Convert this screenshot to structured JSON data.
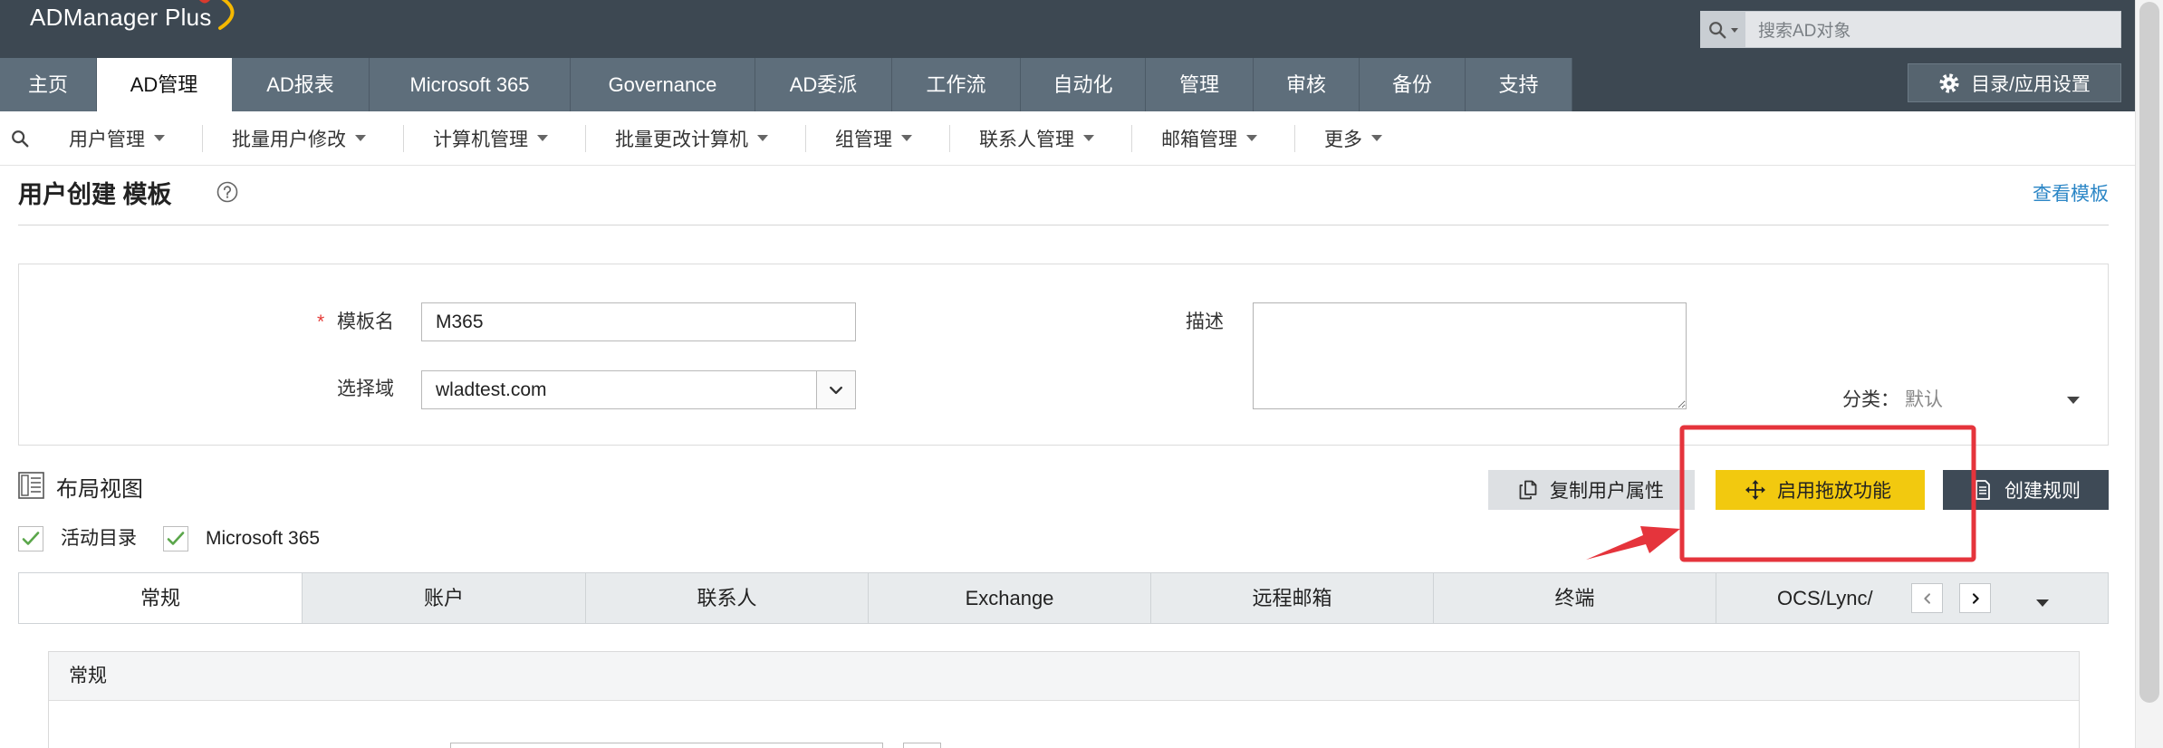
{
  "app": {
    "logo_text": "ADManager Plus"
  },
  "header_search": {
    "placeholder": "搜索AD对象"
  },
  "nav": {
    "tabs": [
      {
        "label": "主页",
        "active": false
      },
      {
        "label": "AD管理",
        "active": true
      },
      {
        "label": "AD报表",
        "active": false
      },
      {
        "label": "Microsoft 365",
        "active": false
      },
      {
        "label": "Governance",
        "active": false
      },
      {
        "label": "AD委派",
        "active": false
      },
      {
        "label": "工作流",
        "active": false
      },
      {
        "label": "自动化",
        "active": false
      },
      {
        "label": "管理",
        "active": false
      },
      {
        "label": "审核",
        "active": false
      },
      {
        "label": "备份",
        "active": false
      },
      {
        "label": "支持",
        "active": false
      }
    ],
    "settings_button": {
      "label": "目录/应用设置"
    }
  },
  "subnav": {
    "items": [
      {
        "label": "用户管理"
      },
      {
        "label": "批量用户修改"
      },
      {
        "label": "计算机管理"
      },
      {
        "label": "批量更改计算机"
      },
      {
        "label": "组管理"
      },
      {
        "label": "联系人管理"
      },
      {
        "label": "邮箱管理"
      },
      {
        "label": "更多"
      }
    ]
  },
  "page": {
    "title": "用户创建 模板",
    "view_templates_link": "查看模板"
  },
  "form": {
    "template_name": {
      "required_mark": "*",
      "label": "模板名",
      "value": "M365"
    },
    "domain": {
      "label": "选择域",
      "value": "wladtest.com"
    },
    "description": {
      "label": "描述",
      "value": ""
    },
    "category": {
      "label": "分类：",
      "value": "默认"
    }
  },
  "layout_view": {
    "title": "布局视图",
    "buttons": {
      "copy_attributes": "复制用户属性",
      "enable_drag_drop": "启用拖放功能",
      "create_rule": "创建规则"
    }
  },
  "filters": [
    {
      "label": "活动目录",
      "checked": true
    },
    {
      "label": "Microsoft 365",
      "checked": true
    }
  ],
  "attribute_tabs": [
    {
      "label": "常规",
      "active": true
    },
    {
      "label": "账户",
      "active": false
    },
    {
      "label": "联系人",
      "active": false
    },
    {
      "label": "Exchange",
      "active": false
    },
    {
      "label": "远程邮箱",
      "active": false
    },
    {
      "label": "终端",
      "active": false
    },
    {
      "label": "OCS/Lync/",
      "active": false
    }
  ],
  "section": {
    "title": "常规"
  },
  "icons": {
    "header_search": "search-icon",
    "settings": "gear-icon",
    "quick_search": "search-icon",
    "help": "help-circle-icon",
    "layout_view": "layout-icon",
    "copy": "copy-icon",
    "drag_drop": "move-icon",
    "create_rule": "document-icon",
    "checkbox": "check-icon",
    "dropdown": "chevron-down-icon",
    "tab_prev": "chevron-left-icon",
    "tab_next": "chevron-right-icon"
  },
  "colors": {
    "header_bg": "#3d4852",
    "nav_tab_bg": "#5e6e7b",
    "link": "#2b86c6",
    "drag_button": "#f2c90f",
    "rule_button": "#3e4a56",
    "check": "#5aa64a",
    "required": "#e53935",
    "annotation": "#e5343c"
  }
}
